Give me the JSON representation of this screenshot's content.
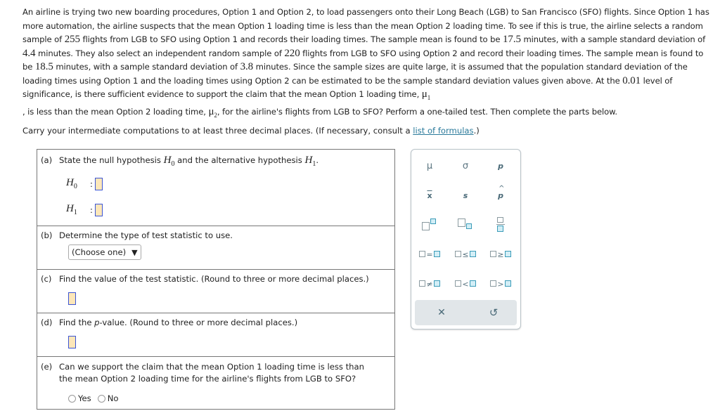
{
  "problem": {
    "sentences": [
      "An airline is trying two new boarding procedures, Option 1 and Option 2, to load passengers onto their Long Beach (LGB) to San Francisco (SFO) flights. Since Option 1 has more automation, the airline suspects that the mean Option 1 loading time is less than the mean Option 2 loading time. To see if this is true, the airline selects a random sample of ",
      " flights from LGB to SFO using Option 1 and records their loading times. The sample mean is found to be ",
      " minutes, with a sample standard deviation of ",
      " minutes. They also select an independent random sample of ",
      " flights from LGB to SFO using Option 2 and record their loading times. The sample mean is found to be ",
      " minutes, with a sample standard deviation of ",
      " minutes. Since the sample sizes are quite large, it is assumed that the population standard deviation of the loading times using Option 1 and the loading times using Option 2 can be estimated to be the sample standard deviation values given above. At the ",
      " level of significance, is there sufficient evidence to support the claim that the mean Option 1 loading time, ",
      ", is less than the mean Option 2 loading time, ",
      ", for the airline's flights from LGB to SFO? Perform a one-tailed test. Then complete the parts below."
    ],
    "values": {
      "n1": "255",
      "mean1": "17.5",
      "sd1": "4.4",
      "n2": "220",
      "mean2": "18.5",
      "sd2": "3.8",
      "alpha": "0.01",
      "mu1": "μ",
      "mu1_sub": "1",
      "mu2": "μ",
      "mu2_sub": "2"
    }
  },
  "instructions": {
    "text": "Carry your intermediate computations to at least three decimal places. (If necessary, consult a ",
    "link": "list of formulas",
    "after": ".)"
  },
  "parts": {
    "a": {
      "label": "(a)",
      "text_before": "State the null hypothesis ",
      "text_mid": " and the alternative hypothesis ",
      "text_after": ".",
      "h0": "H",
      "h0_sub": "0",
      "h1": "H",
      "h1_sub": "1",
      "colon": ":"
    },
    "b": {
      "label": "(b)",
      "text": "Determine the type of test statistic to use.",
      "select_value": "(Choose one)",
      "select_arrow": "▼"
    },
    "c": {
      "label": "(c)",
      "text": "Find the value of the test statistic. (Round to three or more decimal places.)"
    },
    "d": {
      "label": "(d)",
      "text_before": "Find the ",
      "p": "p",
      "text_after": "-value. (Round to three or more decimal places.)"
    },
    "e": {
      "label": "(e)",
      "text_line1": "Can we support the claim that the mean Option 1 loading time is less than",
      "text_line2": "the mean Option 2 loading time for the airline's flights from LGB to SFO?",
      "options": [
        "Yes",
        "No"
      ]
    }
  },
  "palette": {
    "row1": [
      "μ",
      "σ",
      "p"
    ],
    "row2": [
      "x",
      "s",
      "p"
    ],
    "ops": [
      "=",
      "≤",
      "≥",
      "≠",
      "<",
      ">"
    ],
    "footer": {
      "clear_icon": "✕",
      "undo_icon": "↺"
    },
    "colors": {
      "accent_border": "#3a9bb8",
      "accent_fill": "#d3eef6",
      "footer_bg": "#e1e6e9"
    }
  },
  "colors": {
    "answer_fill": "#fde7b9",
    "answer_border": "#3b55d6",
    "link": "#2a7a9b"
  }
}
